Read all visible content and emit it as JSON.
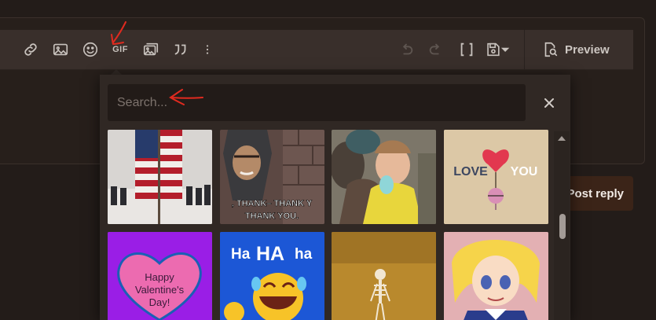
{
  "toolbar": {
    "icons": [
      "link-icon",
      "image-icon",
      "smiley-icon",
      "gif-icon",
      "media-icon",
      "quote-icon",
      "more-icon",
      "undo-icon",
      "redo-icon",
      "fullscreen-icon",
      "save-draft-icon"
    ],
    "gif_label": "GIF",
    "preview_label": "Preview"
  },
  "post_reply_label": "Post reply",
  "gif_picker": {
    "search_placeholder": "Search...",
    "results": [
      {
        "name": "flag-gif",
        "caption": ""
      },
      {
        "name": "thank-you-gif",
        "caption": "THANK— THANK YOU. THANK YOU."
      },
      {
        "name": "baby-gif",
        "caption": ""
      },
      {
        "name": "love-you-gif",
        "caption": "LOVE YOU"
      },
      {
        "name": "valentines-gif",
        "caption": "Happy Valentine's Day!"
      },
      {
        "name": "hahaha-gif",
        "caption": "HaHA ha"
      },
      {
        "name": "skeleton-gif",
        "caption": ""
      },
      {
        "name": "anime-crying-gif",
        "caption": ""
      }
    ]
  },
  "colors": {
    "page_bg": "#231c19",
    "toolbar_bg": "#392f2b",
    "popup_bg": "#302824",
    "annotation_red": "#e02a1f"
  }
}
